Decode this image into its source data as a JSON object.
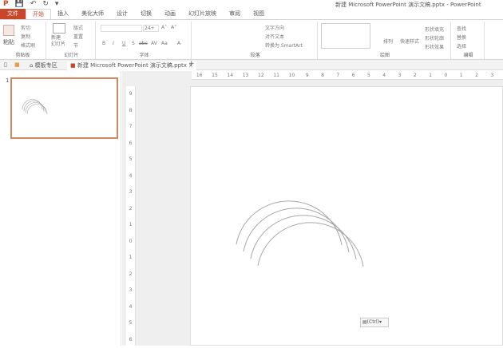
{
  "window": {
    "title": "新建 Microsoft PowerPoint 演示文稿.pptx - PowerPoint"
  },
  "qat": {
    "logo": "P",
    "save": "💾",
    "undo": "↶",
    "redo": "↻",
    "more": "▾"
  },
  "tabs": [
    "文件",
    "开始",
    "插入",
    "美化大师",
    "设计",
    "切换",
    "动画",
    "幻灯片放映",
    "审阅",
    "视图"
  ],
  "ribbon": {
    "clipboard": {
      "paste": "粘贴",
      "cut": "剪切",
      "copy": "复制",
      "format_painter": "格式刷",
      "label": "剪贴板"
    },
    "slides": {
      "new_slide": "新建\n幻灯片",
      "layout": "版式",
      "reset": "重置",
      "section": "节",
      "label": "幻灯片"
    },
    "font": {
      "size": "24+",
      "bold": "B",
      "italic": "I",
      "underline": "U",
      "shadow": "S",
      "strike": "abc",
      "spacing": "AV",
      "case": "Aa",
      "color": "A",
      "grow": "A˄",
      "shrink": "A˅",
      "label": "字体"
    },
    "paragraph": {
      "text_direction": "文字方向",
      "align_text": "对齐文本",
      "smartart": "转换为 SmartArt",
      "label": "段落"
    },
    "drawing": {
      "arrange": "排列",
      "quick_styles": "快速样式",
      "fill": "形状填充",
      "outline": "形状轮廓",
      "effects": "形状效果",
      "label": "绘图"
    },
    "editing": {
      "find": "查找",
      "replace": "替换",
      "select": "选择",
      "label": "编辑"
    }
  },
  "doctabs": {
    "template": "模板专区",
    "doc": "新建 Microsoft PowerPoint 演示文稿.pptx",
    "close": "×",
    "add": "+"
  },
  "thumbnails": [
    {
      "number": "1"
    }
  ],
  "hruler": [
    "16",
    "15",
    "14",
    "13",
    "12",
    "11",
    "10",
    "9",
    "8",
    "7",
    "6",
    "5",
    "4",
    "3",
    "2",
    "1",
    "0",
    "1",
    "2",
    "3"
  ],
  "vruler": [
    "9",
    "8",
    "7",
    "6",
    "5",
    "4",
    "3",
    "2",
    "1",
    "0",
    "1",
    "2",
    "3",
    "4",
    "5",
    "6"
  ],
  "paste_options": {
    "label": "(Ctrl)",
    "arrow": "▾"
  }
}
